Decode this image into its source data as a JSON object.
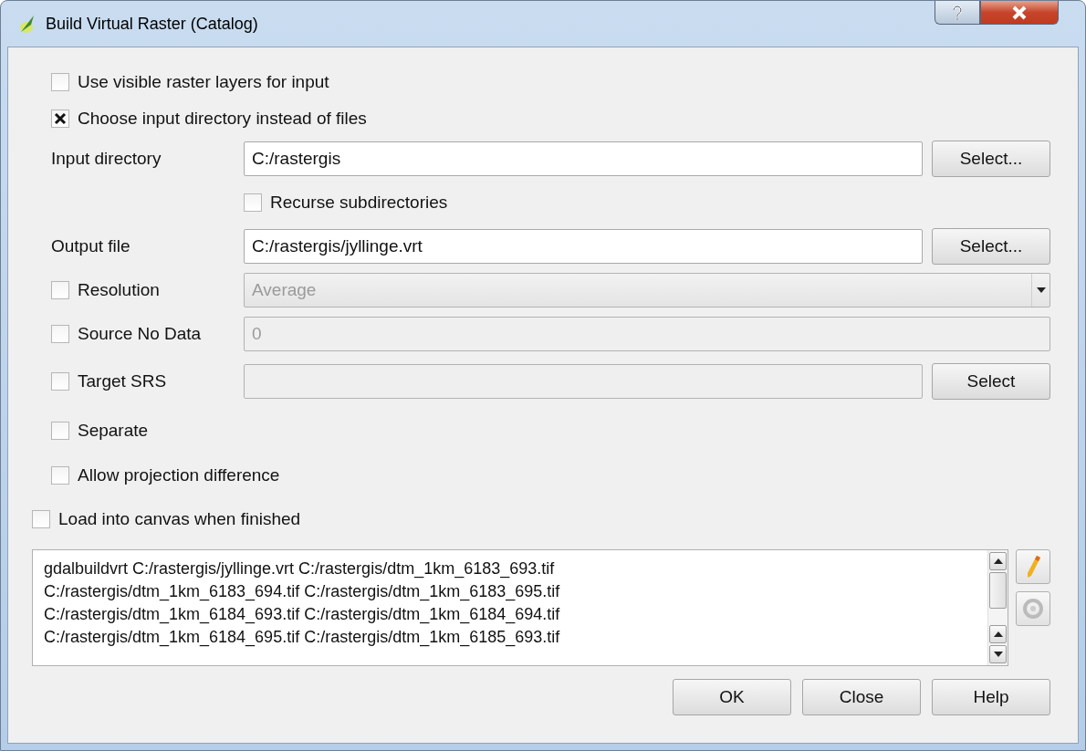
{
  "window": {
    "title": "Build Virtual Raster (Catalog)"
  },
  "options": [
    {
      "label": "Use visible raster layers for input",
      "checked": false
    },
    {
      "label": "Choose input directory instead of files",
      "checked": true
    }
  ],
  "rows": [
    {
      "kind": "field",
      "label": "Input directory",
      "value": "C:/rastergis",
      "button": "Select...",
      "disabled": false
    },
    {
      "kind": "subcheck",
      "label": "Recurse subdirectories",
      "checked": false
    },
    {
      "kind": "field",
      "label": "Output file",
      "value": "C:/rastergis/jyllinge.vrt",
      "button": "Select...",
      "disabled": false
    },
    {
      "kind": "combo",
      "label": "Resolution",
      "checked": false,
      "value": "Average",
      "disabled": true
    },
    {
      "kind": "checkfield",
      "label": "Source No Data",
      "checked": false,
      "value": "0",
      "disabled": true
    },
    {
      "kind": "checkfield",
      "label": "Target SRS",
      "checked": false,
      "button": "Select",
      "disabled": true
    },
    {
      "kind": "check",
      "label": "Separate",
      "checked": false
    },
    {
      "kind": "check",
      "label": "Allow projection difference",
      "checked": false
    }
  ],
  "load": {
    "label": "Load into canvas when finished",
    "checked": false
  },
  "command": {
    "lines": [
      "gdalbuildvrt C:/rastergis/jyllinge.vrt C:/rastergis/dtm_1km_6183_693.tif",
      "C:/rastergis/dtm_1km_6183_694.tif C:/rastergis/dtm_1km_6183_695.tif",
      "C:/rastergis/dtm_1km_6184_693.tif C:/rastergis/dtm_1km_6184_694.tif",
      "C:/rastergis/dtm_1km_6184_695.tif C:/rastergis/dtm_1km_6185_693.tif"
    ]
  },
  "buttons": [
    "OK",
    "Close",
    "Help"
  ]
}
